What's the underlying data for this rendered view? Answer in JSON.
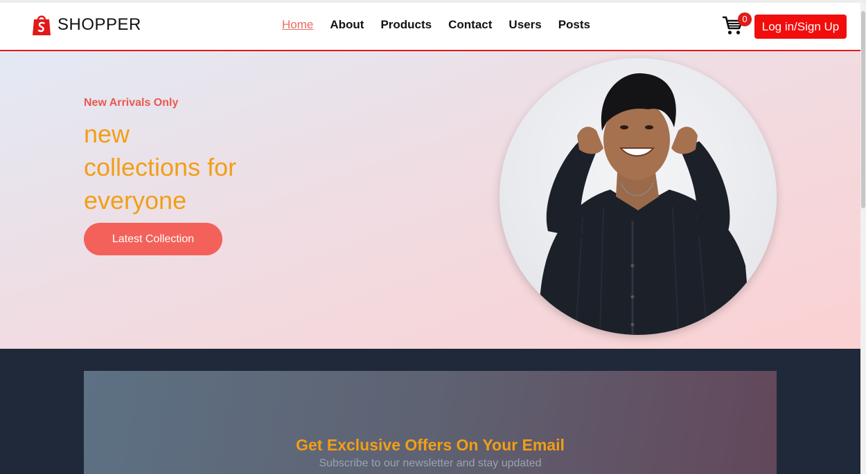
{
  "brand": {
    "name": "SHOPPER",
    "logo_icon": "shopping-bag-icon",
    "logo_color": "#e01a1a"
  },
  "nav": {
    "items": [
      {
        "label": "Home",
        "active": true
      },
      {
        "label": "About",
        "active": false
      },
      {
        "label": "Products",
        "active": false
      },
      {
        "label": "Contact",
        "active": false
      },
      {
        "label": "Users",
        "active": false
      },
      {
        "label": "Posts",
        "active": false
      }
    ]
  },
  "cart": {
    "icon": "cart-icon",
    "count": "0"
  },
  "auth": {
    "login_label": "Log in/Sign Up"
  },
  "hero": {
    "tagline": "New Arrivals Only",
    "title_line1": "new",
    "title_line2": "collections for",
    "title_line3": "everyone",
    "cta_label": "Latest Collection"
  },
  "newsletter": {
    "title": "Get Exclusive Offers On Your Email",
    "subtitle": "Subscribe to our newsletter and stay updated"
  },
  "colors": {
    "accent_red": "#f20d0d",
    "active_link": "#ee6a5e",
    "hero_title": "#f29e16",
    "cta": "#f4615a",
    "footer_bg": "#1f2939"
  }
}
